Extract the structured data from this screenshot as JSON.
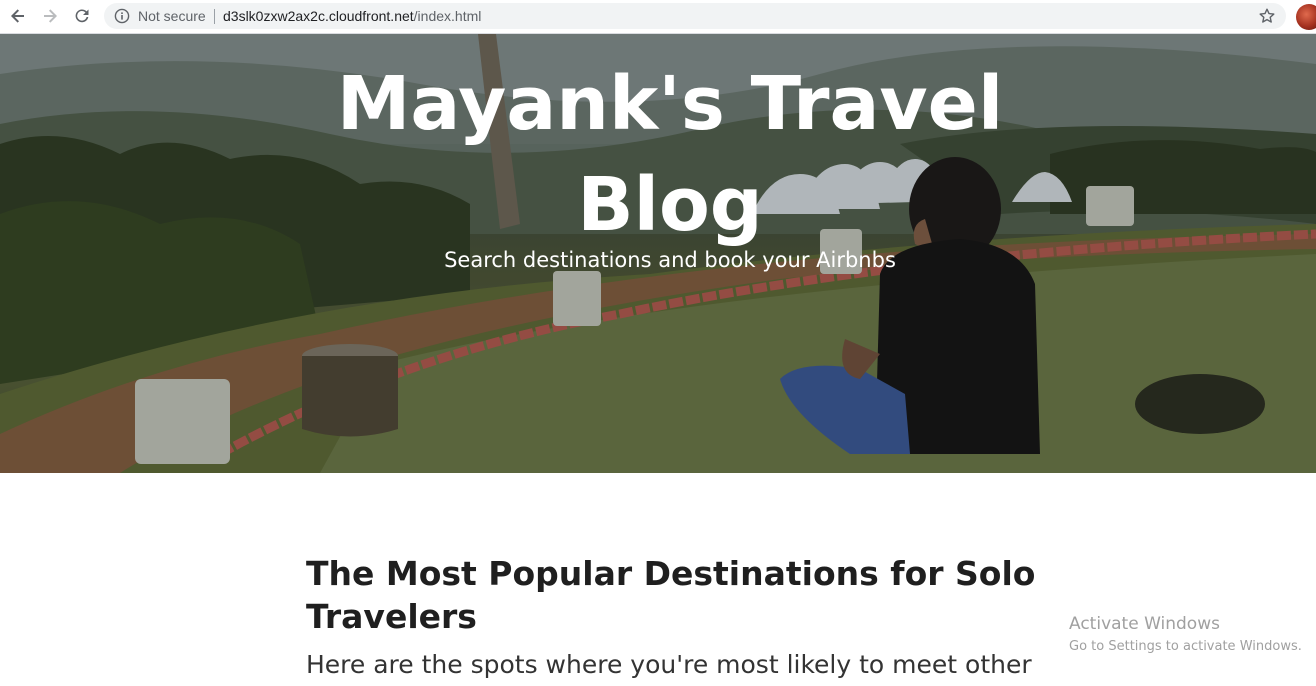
{
  "browser": {
    "security_label": "Not secure",
    "url_host": "d3slk0zxw2ax2c.cloudfront.net",
    "url_path": "/index.html",
    "icons": [
      "back-arrow-icon",
      "forward-arrow-icon",
      "reload-icon",
      "info-icon",
      "star-icon"
    ]
  },
  "hero": {
    "title": "Mayank's Travel Blog",
    "subtitle": "Search destinations and book your Airbnbs"
  },
  "article": {
    "title": "The Most Popular Destinations for Solo Travelers",
    "subtitle": "Here are the spots where you're most likely to meet other"
  },
  "watermark": {
    "title": "Activate Windows",
    "subtitle": "Go to Settings to activate Windows."
  },
  "colors": {
    "page_background": "#ffffff",
    "heading_text": "#1f1f1f",
    "hero_text": "#ffffff",
    "omnibox": "#f1f3f4"
  }
}
